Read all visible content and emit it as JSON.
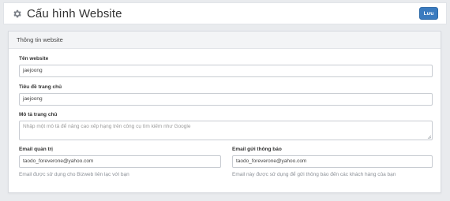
{
  "header": {
    "title": "Cấu hình Website",
    "save_label": "Lưu",
    "icon": "gear-icon"
  },
  "panel": {
    "title": "Thông tin website"
  },
  "fields": {
    "website_name": {
      "label": "Tên website",
      "value": "jaejoong"
    },
    "homepage_title": {
      "label": "Tiêu đề trang chủ",
      "value": "jaejoong"
    },
    "homepage_description": {
      "label": "Mô tả trang chủ",
      "placeholder": "Nhập một mô tả để nâng cao xếp hạng trên công cụ tìm kiếm như Google",
      "value": ""
    },
    "admin_email": {
      "label": "Email quản trị",
      "value": "taodo_foreverone@yahoo.com",
      "help": "Email được sử dụng cho Bizweb liên lạc với bạn"
    },
    "notification_email": {
      "label": "Email gửi thông báo",
      "value": "taodo_foreverone@yahoo.com",
      "help": "Email này được sử dụng để gửi thông báo đến các khách hàng của bạn"
    }
  },
  "colors": {
    "accent": "#3a7bbf",
    "background": "#e9ebee"
  }
}
